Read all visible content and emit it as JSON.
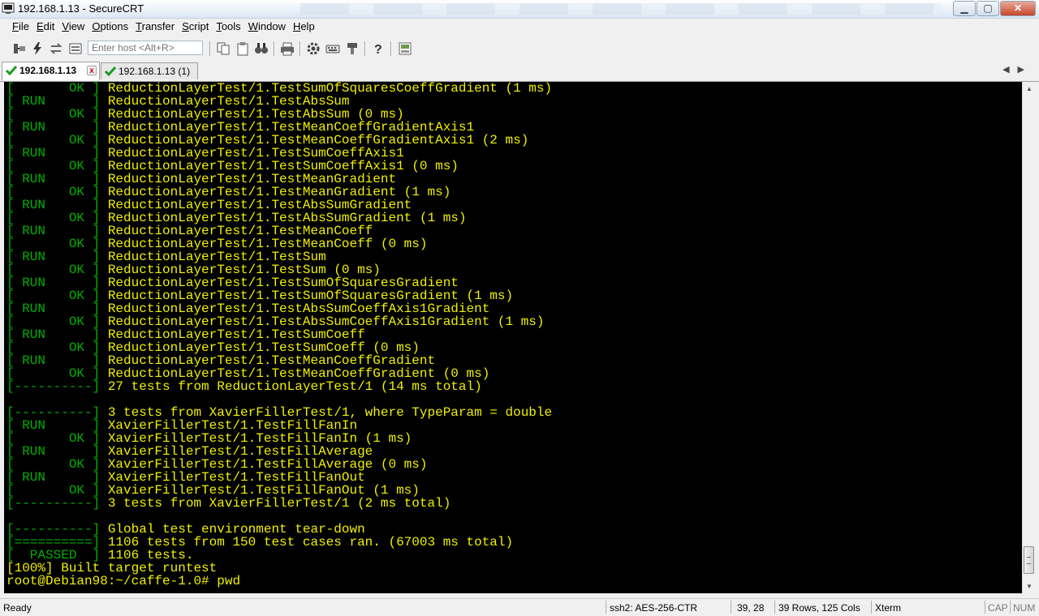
{
  "window": {
    "title": "192.168.1.13 - SecureCRT"
  },
  "window_controls": {
    "minimize": "▁",
    "maximize": "▢",
    "close": "✕"
  },
  "menu": [
    "File",
    "Edit",
    "View",
    "Options",
    "Transfer",
    "Script",
    "Tools",
    "Window",
    "Help"
  ],
  "toolbar": {
    "host_placeholder": "Enter host <Alt+R>",
    "icons": [
      "connect-icon",
      "lightning-icon",
      "reconnect-icon",
      "copy-icon",
      "paste-icon",
      "find-icon",
      "print-icon",
      "settings-icon",
      "keymap-icon",
      "sftp-icon",
      "help-icon",
      "session-manager-icon"
    ]
  },
  "tabs": [
    {
      "label": "192.168.1.13",
      "active": true,
      "close": "x"
    },
    {
      "label": "192.168.1.13 (1)",
      "active": false
    }
  ],
  "tab_nav": {
    "prev": "◀",
    "next": "▶"
  },
  "terminal": {
    "lines": [
      {
        "tag": "[       OK ]",
        "text": " ReductionLayerTest/1.TestSumOfSquaresCoeffGradient (1 ms)"
      },
      {
        "tag": "[ RUN      ]",
        "text": " ReductionLayerTest/1.TestAbsSum"
      },
      {
        "tag": "[       OK ]",
        "text": " ReductionLayerTest/1.TestAbsSum (0 ms)"
      },
      {
        "tag": "[ RUN      ]",
        "text": " ReductionLayerTest/1.TestMeanCoeffGradientAxis1"
      },
      {
        "tag": "[       OK ]",
        "text": " ReductionLayerTest/1.TestMeanCoeffGradientAxis1 (2 ms)"
      },
      {
        "tag": "[ RUN      ]",
        "text": " ReductionLayerTest/1.TestSumCoeffAxis1"
      },
      {
        "tag": "[       OK ]",
        "text": " ReductionLayerTest/1.TestSumCoeffAxis1 (0 ms)"
      },
      {
        "tag": "[ RUN      ]",
        "text": " ReductionLayerTest/1.TestMeanGradient"
      },
      {
        "tag": "[       OK ]",
        "text": " ReductionLayerTest/1.TestMeanGradient (1 ms)"
      },
      {
        "tag": "[ RUN      ]",
        "text": " ReductionLayerTest/1.TestAbsSumGradient"
      },
      {
        "tag": "[       OK ]",
        "text": " ReductionLayerTest/1.TestAbsSumGradient (1 ms)"
      },
      {
        "tag": "[ RUN      ]",
        "text": " ReductionLayerTest/1.TestMeanCoeff"
      },
      {
        "tag": "[       OK ]",
        "text": " ReductionLayerTest/1.TestMeanCoeff (0 ms)"
      },
      {
        "tag": "[ RUN      ]",
        "text": " ReductionLayerTest/1.TestSum"
      },
      {
        "tag": "[       OK ]",
        "text": " ReductionLayerTest/1.TestSum (0 ms)"
      },
      {
        "tag": "[ RUN      ]",
        "text": " ReductionLayerTest/1.TestSumOfSquaresGradient"
      },
      {
        "tag": "[       OK ]",
        "text": " ReductionLayerTest/1.TestSumOfSquaresGradient (1 ms)"
      },
      {
        "tag": "[ RUN      ]",
        "text": " ReductionLayerTest/1.TestAbsSumCoeffAxis1Gradient"
      },
      {
        "tag": "[       OK ]",
        "text": " ReductionLayerTest/1.TestAbsSumCoeffAxis1Gradient (1 ms)"
      },
      {
        "tag": "[ RUN      ]",
        "text": " ReductionLayerTest/1.TestSumCoeff"
      },
      {
        "tag": "[       OK ]",
        "text": " ReductionLayerTest/1.TestSumCoeff (0 ms)"
      },
      {
        "tag": "[ RUN      ]",
        "text": " ReductionLayerTest/1.TestMeanCoeffGradient"
      },
      {
        "tag": "[       OK ]",
        "text": " ReductionLayerTest/1.TestMeanCoeffGradient (0 ms)"
      },
      {
        "tag": "[----------]",
        "text": " 27 tests from ReductionLayerTest/1 (14 ms total)"
      },
      {
        "tag": "",
        "text": ""
      },
      {
        "tag": "[----------]",
        "text": " 3 tests from XavierFillerTest/1, where TypeParam = double"
      },
      {
        "tag": "[ RUN      ]",
        "text": " XavierFillerTest/1.TestFillFanIn"
      },
      {
        "tag": "[       OK ]",
        "text": " XavierFillerTest/1.TestFillFanIn (1 ms)"
      },
      {
        "tag": "[ RUN      ]",
        "text": " XavierFillerTest/1.TestFillAverage"
      },
      {
        "tag": "[       OK ]",
        "text": " XavierFillerTest/1.TestFillAverage (0 ms)"
      },
      {
        "tag": "[ RUN      ]",
        "text": " XavierFillerTest/1.TestFillFanOut"
      },
      {
        "tag": "[       OK ]",
        "text": " XavierFillerTest/1.TestFillFanOut (1 ms)"
      },
      {
        "tag": "[----------]",
        "text": " 3 tests from XavierFillerTest/1 (2 ms total)"
      },
      {
        "tag": "",
        "text": ""
      },
      {
        "tag": "[----------]",
        "text": " Global test environment tear-down"
      },
      {
        "tag": "[==========]",
        "text": " 1106 tests from 150 test cases ran. (67003 ms total)"
      },
      {
        "tag": "[  PASSED  ]",
        "text": " 1106 tests."
      },
      {
        "tag": "",
        "text": "[100%] Built target runtest"
      },
      {
        "tag": "",
        "text": "root@Debian98:~/caffe-1.0# pwd"
      }
    ]
  },
  "scrollbar": {
    "up": "▲",
    "down": "▼"
  },
  "status": {
    "ready": "Ready",
    "cipher": "ssh2: AES-256-CTR",
    "cursor": "39,  28",
    "size": "39 Rows, 125 Cols",
    "terminal_type": "Xterm",
    "cap": "CAP",
    "num": "NUM"
  },
  "colors": {
    "terminal_bg": "#000000",
    "terminal_text": "#f0f000",
    "terminal_tag": "#00b000"
  }
}
